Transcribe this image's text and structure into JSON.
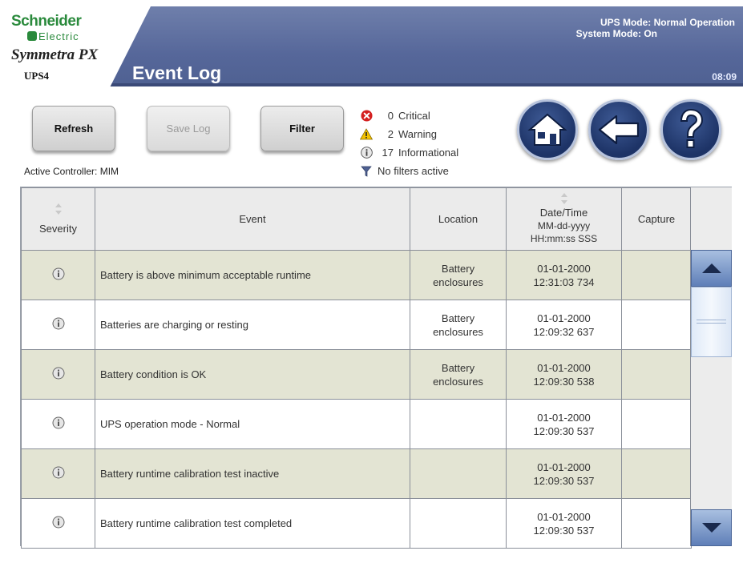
{
  "header": {
    "brand": "Schneider",
    "brand_sub": "Electric",
    "product": "Symmetra PX",
    "unit": "UPS4",
    "title": "Event Log",
    "ups_mode": "UPS Mode: Normal Operation",
    "system_mode": "System Mode: On",
    "clock": "08:09"
  },
  "toolbar": {
    "refresh_label": "Refresh",
    "save_log_label": "Save Log",
    "filter_label": "Filter",
    "active_controller": "Active Controller: MIM"
  },
  "counts": {
    "critical_count": "0",
    "critical_label": "Critical",
    "warning_count": "2",
    "warning_label": "Warning",
    "info_count": "17",
    "info_label": "Informational",
    "filter_status": "No filters active"
  },
  "nav": {
    "home_icon": "home-icon",
    "back_icon": "back-arrow-icon",
    "help_icon": "help-icon"
  },
  "table": {
    "headers": {
      "severity": "Severity",
      "event": "Event",
      "location": "Location",
      "datetime": "Date/Time",
      "datetime_fmt1": "MM-dd-yyyy",
      "datetime_fmt2": "HH:mm:ss SSS",
      "capture": "Capture"
    },
    "rows": [
      {
        "severity": "info",
        "event": "Battery is above minimum acceptable runtime",
        "loc1": "Battery",
        "loc2": "enclosures",
        "date": "01-01-2000",
        "time": "12:31:03 734",
        "capture": ""
      },
      {
        "severity": "info",
        "event": "Batteries are charging or resting",
        "loc1": "Battery",
        "loc2": "enclosures",
        "date": "01-01-2000",
        "time": "12:09:32 637",
        "capture": ""
      },
      {
        "severity": "info",
        "event": "Battery condition is OK",
        "loc1": "Battery",
        "loc2": "enclosures",
        "date": "01-01-2000",
        "time": "12:09:30 538",
        "capture": ""
      },
      {
        "severity": "info",
        "event": "UPS operation mode - Normal",
        "loc1": "",
        "loc2": "",
        "date": "01-01-2000",
        "time": "12:09:30 537",
        "capture": ""
      },
      {
        "severity": "info",
        "event": "Battery runtime calibration test inactive",
        "loc1": "",
        "loc2": "",
        "date": "01-01-2000",
        "time": "12:09:30 537",
        "capture": ""
      },
      {
        "severity": "info",
        "event": "Battery runtime calibration test completed",
        "loc1": "",
        "loc2": "",
        "date": "01-01-2000",
        "time": "12:09:30 537",
        "capture": ""
      }
    ]
  },
  "colors": {
    "header_band": "#56679a",
    "row_shaded": "#e3e4d3",
    "brand_green": "#2a8a3c",
    "scroll_button": "#5f7fb8"
  }
}
